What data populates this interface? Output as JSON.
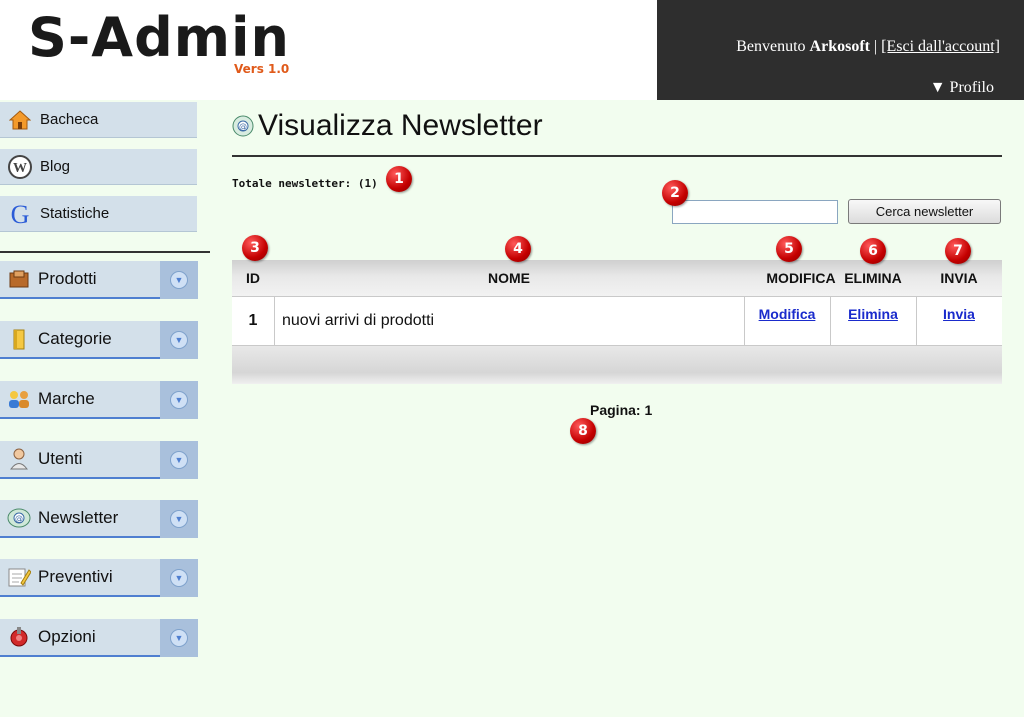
{
  "header": {
    "logo_text": "S-Admin",
    "logo_version": "Vers 1.0",
    "welcome_prefix": "Benvenuto",
    "username": "Arkosoft",
    "logout_label": "[Esci dall'account]",
    "profile_label": "▼ Profilo"
  },
  "sidebar": {
    "simple_items": [
      {
        "label": "Bacheca",
        "icon": "home-icon"
      },
      {
        "label": "Blog",
        "icon": "wordpress-icon"
      },
      {
        "label": "Statistiche",
        "icon": "google-icon"
      }
    ],
    "menu_items": [
      {
        "label": "Prodotti",
        "icon": "box-icon"
      },
      {
        "label": "Categorie",
        "icon": "folder-icon"
      },
      {
        "label": "Marche",
        "icon": "users-icon"
      },
      {
        "label": "Utenti",
        "icon": "user-icon"
      },
      {
        "label": "Newsletter",
        "icon": "newsletter-icon"
      },
      {
        "label": "Preventivi",
        "icon": "notepad-icon"
      },
      {
        "label": "Opzioni",
        "icon": "options-icon"
      }
    ]
  },
  "main": {
    "title": "Visualizza Newsletter",
    "total_label": "Totale newsletter: (1)",
    "search": {
      "value": "",
      "button_label": "Cerca newsletter"
    },
    "table": {
      "columns": [
        "ID",
        "NOME",
        "MODIFICA",
        "ELIMINA",
        "INVIA"
      ],
      "rows": [
        {
          "id": "1",
          "nome": "nuovi arrivi di prodotti",
          "modifica": "Modifica",
          "elimina": "Elimina",
          "invia": "Invia"
        }
      ]
    },
    "pagination": "Pagina: 1"
  },
  "markers": [
    "1",
    "2",
    "3",
    "4",
    "5",
    "6",
    "7",
    "8"
  ],
  "colors": {
    "accent": "#4f7fd0",
    "sidebar_bg": "#d3e0ea",
    "page_bg": "#f2fdef",
    "header_dark": "#2e2e2e",
    "marker_red": "#c40000",
    "link": "#1a2bcc"
  }
}
